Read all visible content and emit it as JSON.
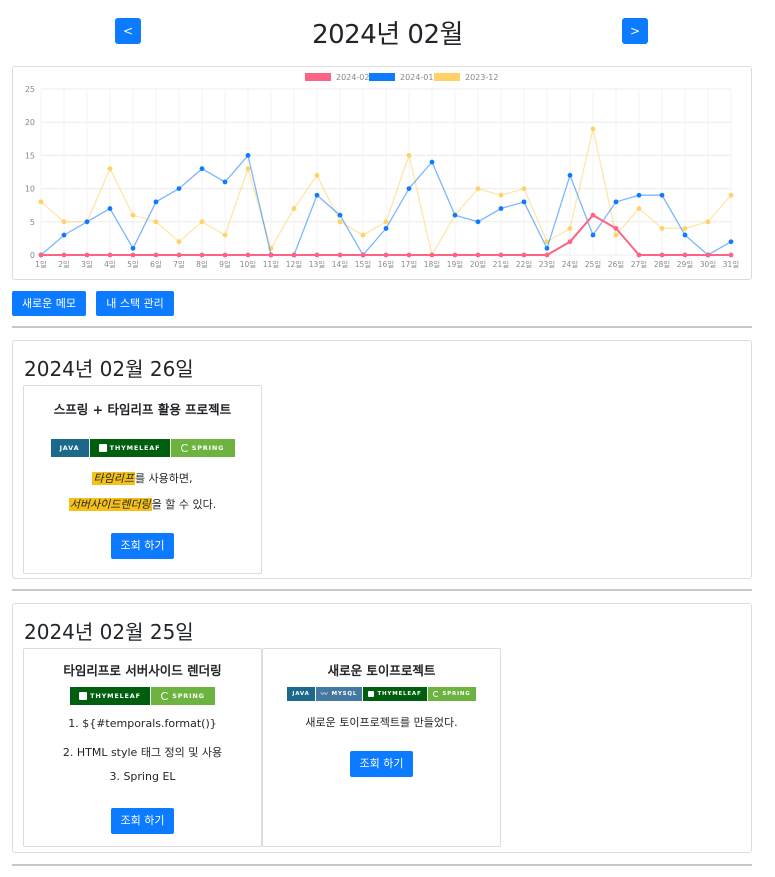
{
  "header": {
    "title": "2024년 02월",
    "prev_label": "<",
    "next_label": ">"
  },
  "actions": {
    "new_memo": "새로운 메모",
    "manage_stack": "내 스택 관리"
  },
  "chart_data": {
    "type": "line",
    "categories": [
      "1일",
      "2일",
      "3일",
      "4일",
      "5일",
      "6일",
      "7일",
      "8일",
      "9일",
      "10일",
      "11일",
      "12일",
      "13일",
      "14일",
      "15일",
      "16일",
      "17일",
      "18일",
      "19일",
      "20일",
      "21일",
      "22일",
      "23일",
      "24일",
      "25일",
      "26일",
      "27일",
      "28일",
      "29일",
      "30일",
      "31일"
    ],
    "series": [
      {
        "name": "2024-02",
        "color": "#ff6384",
        "values": [
          0,
          0,
          0,
          0,
          0,
          0,
          0,
          0,
          0,
          0,
          0,
          0,
          0,
          0,
          0,
          0,
          0,
          0,
          0,
          0,
          0,
          0,
          0,
          2,
          6,
          4,
          0,
          0,
          0,
          0,
          0
        ]
      },
      {
        "name": "2024-01",
        "color": "#0d7bff",
        "values": [
          0,
          3,
          5,
          7,
          1,
          8,
          10,
          13,
          11,
          15,
          0,
          0,
          9,
          6,
          0,
          4,
          10,
          14,
          6,
          5,
          7,
          8,
          1,
          12,
          3,
          8,
          9,
          9,
          3,
          0,
          2
        ]
      },
      {
        "name": "2023-12",
        "color": "#ffd166",
        "values": [
          8,
          5,
          5,
          13,
          6,
          5,
          2,
          5,
          3,
          13,
          1,
          7,
          12,
          5,
          3,
          5,
          15,
          0,
          6,
          10,
          9,
          10,
          2,
          4,
          19,
          3,
          7,
          4,
          4,
          5,
          9
        ]
      }
    ],
    "title": "",
    "xlabel": "",
    "ylabel": "",
    "ylim": [
      0,
      25
    ],
    "yticks": [
      "0",
      "5",
      "10",
      "15",
      "20",
      "25"
    ],
    "grid": true,
    "legend": "top-center"
  },
  "sections": [
    {
      "date": "2024년 02월 26일",
      "cards": [
        {
          "title": "스프링 + 타임리프 활용 프로젝트",
          "badges": [
            {
              "label": "JAVA",
              "color": "#1b6a8c"
            },
            {
              "label": "THYMELEAF",
              "color": "#005f0f"
            },
            {
              "label": "SPRING",
              "color": "#6db33f"
            }
          ],
          "lines": [
            {
              "hl": "타임리프",
              "rest": "를 사용하면,"
            },
            {
              "hl": "서버사이드렌더링",
              "rest": "을 할 수 있다."
            }
          ],
          "button": "조회 하기"
        }
      ]
    },
    {
      "date": "2024년 02월 25일",
      "cards": [
        {
          "title": "타임리프로 서버사이드 렌더링",
          "badges": [
            {
              "label": "THYMELEAF",
              "color": "#005f0f"
            },
            {
              "label": "SPRING",
              "color": "#6db33f"
            }
          ],
          "lines": [
            "1. ${#temporals.format()}",
            "2. HTML style 태그 정의 및 사용",
            "3. Spring EL"
          ],
          "button": "조회 하기"
        },
        {
          "title": "새로운 토이프로젝트",
          "badges": [
            {
              "label": "JAVA",
              "color": "#1b6a8c"
            },
            {
              "label": "MYSQL",
              "color": "#4479a1"
            },
            {
              "label": "THYMELEAF",
              "color": "#005f0f"
            },
            {
              "label": "SPRING",
              "color": "#6db33f"
            }
          ],
          "lines": [
            "새로운 토이프로젝트를 만들었다."
          ],
          "button": "조회 하기"
        }
      ]
    }
  ]
}
